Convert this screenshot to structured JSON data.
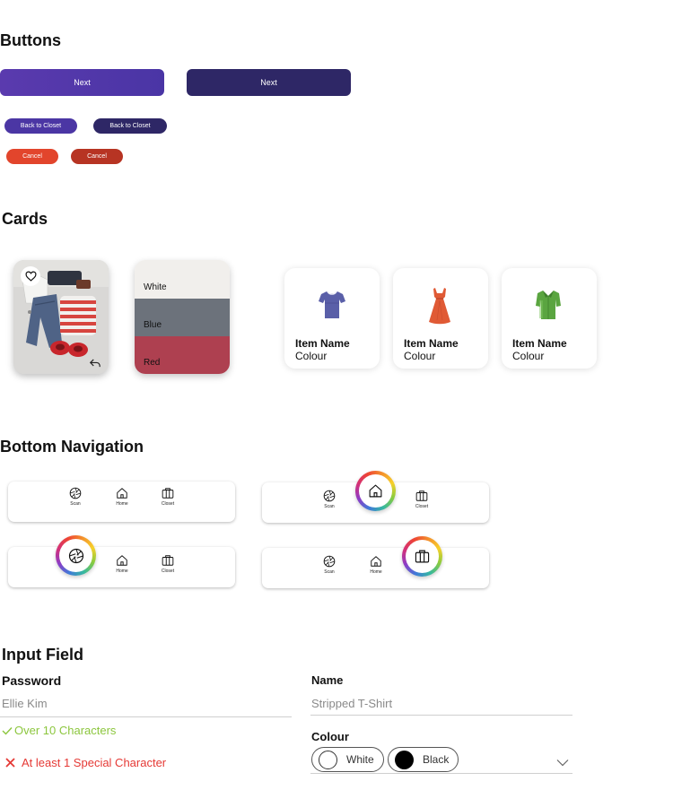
{
  "sections": {
    "buttons": "Buttons",
    "cards": "Cards",
    "bottom_nav": "Bottom Navigation",
    "input_field": "Input Field"
  },
  "buttons": {
    "next": "Next",
    "back": "Back to Closet",
    "cancel": "Cancel"
  },
  "colour_card": {
    "white": "White",
    "blue": "Blue",
    "red": "Red"
  },
  "items": [
    {
      "name": "Item Name",
      "colour": "Colour",
      "icon": "tshirt-icon"
    },
    {
      "name": "Item Name",
      "colour": "Colour",
      "icon": "dress-icon"
    },
    {
      "name": "Item Name",
      "colour": "Colour",
      "icon": "shirt-icon"
    }
  ],
  "nav": {
    "scan": "Scan",
    "home": "Home",
    "closet": "Closet"
  },
  "form": {
    "password_label": "Password",
    "password_value": "Ellie Kim",
    "rule_ok": "Over 10 Characters",
    "rule_fail": "At least 1 Special Character",
    "name_label": "Name",
    "name_value": "Stripped T-Shirt",
    "colour_label": "Colour",
    "colour_options": [
      "White",
      "Black"
    ]
  },
  "colors": {
    "purple": "#4a35a5",
    "dark_purple": "#2d2565",
    "red": "#e0452c",
    "dark_red": "#b83424",
    "ok_green": "#8cc63e",
    "error_red": "#e53935"
  }
}
